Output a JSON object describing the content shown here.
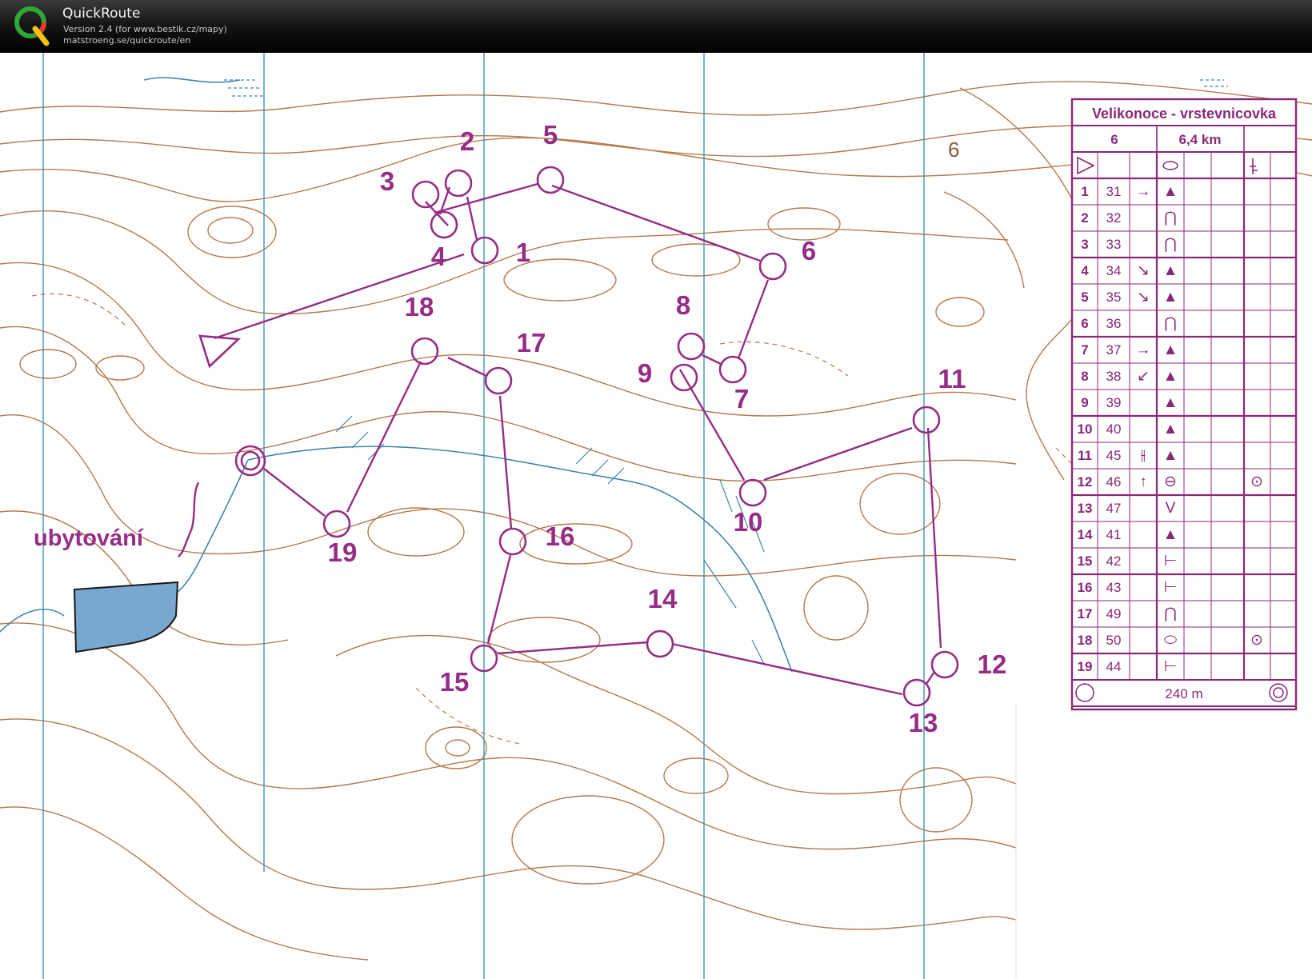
{
  "app": {
    "title": "QuickRoute",
    "version": "Version 2.4  (for www.bestik.cz/mapy)",
    "url": "matstroeng.se/quickroute/en",
    "logo_icon": "quickroute-q-logo"
  },
  "colors": {
    "course": "#952d86",
    "contour": "#b7794a",
    "water": "#3f86b0",
    "lake": "#78a7cf",
    "grid": "#2f8fb5"
  },
  "map": {
    "place_label": "ubytování",
    "north_label": "6",
    "start": {
      "label": "start-triangle"
    },
    "finish": {
      "label": "finish-double-circle"
    },
    "controls": [
      {
        "n": "1"
      },
      {
        "n": "2"
      },
      {
        "n": "3"
      },
      {
        "n": "4"
      },
      {
        "n": "5"
      },
      {
        "n": "6"
      },
      {
        "n": "7"
      },
      {
        "n": "8"
      },
      {
        "n": "9"
      },
      {
        "n": "10"
      },
      {
        "n": "11"
      },
      {
        "n": "12"
      },
      {
        "n": "13"
      },
      {
        "n": "14"
      },
      {
        "n": "15"
      },
      {
        "n": "16"
      },
      {
        "n": "17"
      },
      {
        "n": "18"
      },
      {
        "n": "19"
      }
    ]
  },
  "description": {
    "event": "Velikonoce - vrstevnicovka",
    "course": "6",
    "length": "6,4 km",
    "finish_distance": "240 m",
    "rows": [
      {
        "n": "1",
        "code": "31",
        "dir": "→",
        "feature": "▲",
        "detail": ""
      },
      {
        "n": "2",
        "code": "32",
        "dir": "",
        "feature": "⋂",
        "detail": ""
      },
      {
        "n": "3",
        "code": "33",
        "dir": "",
        "feature": "⋂",
        "detail": ""
      },
      {
        "n": "4",
        "code": "34",
        "dir": "↘",
        "feature": "▲",
        "detail": ""
      },
      {
        "n": "5",
        "code": "35",
        "dir": "↘",
        "feature": "▲",
        "detail": ""
      },
      {
        "n": "6",
        "code": "36",
        "dir": "",
        "feature": "⋂",
        "detail": ""
      },
      {
        "n": "7",
        "code": "37",
        "dir": "→",
        "feature": "▲",
        "detail": ""
      },
      {
        "n": "8",
        "code": "38",
        "dir": "↙",
        "feature": "▲",
        "detail": ""
      },
      {
        "n": "9",
        "code": "39",
        "dir": "",
        "feature": "▲",
        "detail": ""
      },
      {
        "n": "10",
        "code": "40",
        "dir": "",
        "feature": "▲",
        "detail": ""
      },
      {
        "n": "11",
        "code": "45",
        "dir": "⫲",
        "feature": "▲",
        "detail": ""
      },
      {
        "n": "12",
        "code": "46",
        "dir": "↑",
        "feature": "⊖",
        "detail": "⊙"
      },
      {
        "n": "13",
        "code": "47",
        "dir": "",
        "feature": "V",
        "detail": ""
      },
      {
        "n": "14",
        "code": "41",
        "dir": "",
        "feature": "▲",
        "detail": ""
      },
      {
        "n": "15",
        "code": "42",
        "dir": "",
        "feature": "⊢",
        "detail": ""
      },
      {
        "n": "16",
        "code": "43",
        "dir": "",
        "feature": "⊢",
        "detail": ""
      },
      {
        "n": "17",
        "code": "49",
        "dir": "",
        "feature": "⋂",
        "detail": ""
      },
      {
        "n": "18",
        "code": "50",
        "dir": "",
        "feature": "⬭",
        "detail": "⊙"
      },
      {
        "n": "19",
        "code": "44",
        "dir": "",
        "feature": "⊢",
        "detail": ""
      }
    ]
  }
}
